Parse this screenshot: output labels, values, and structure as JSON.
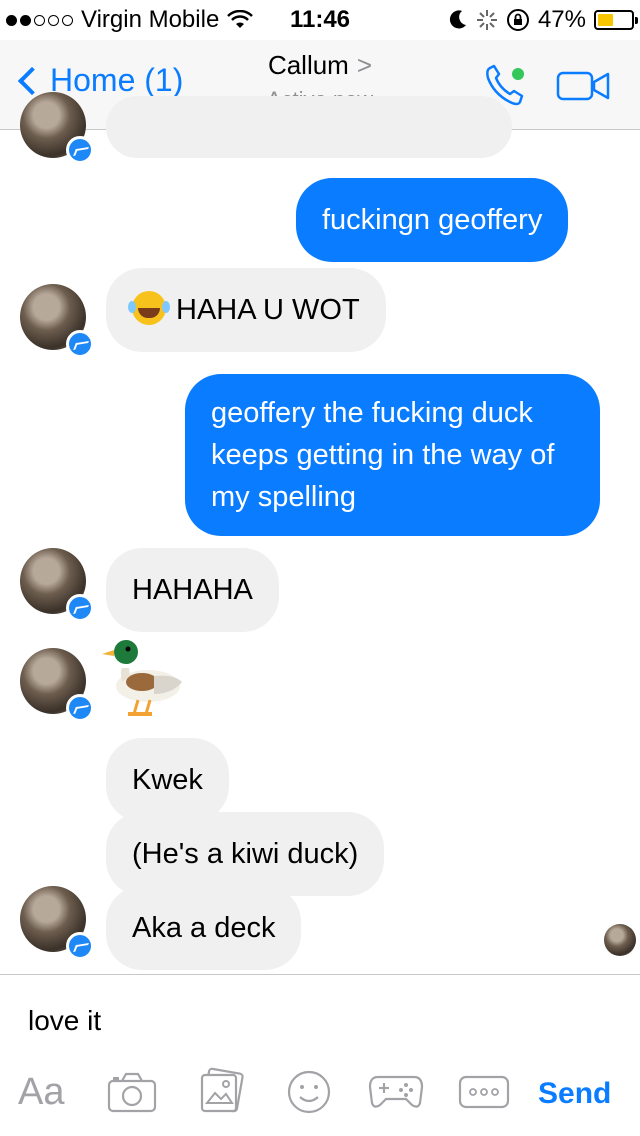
{
  "status_bar": {
    "carrier": "Virgin Mobile",
    "time": "11:46",
    "battery": "47%",
    "battery_level": 0.47,
    "signal_dots_on": 2,
    "signal_dots_total": 5
  },
  "nav": {
    "back_label": "Home (1)",
    "contact_name": "Callum",
    "contact_chevron": ">",
    "presence": "Active now",
    "accent": "#0a7cff",
    "online_dot": "#34c759"
  },
  "messages": [
    {
      "from": "them",
      "text": "fuckingn geoffery",
      "sender": "me"
    },
    {
      "from": "them",
      "text": "HAHA U WOT"
    },
    {
      "from": "me",
      "text": "geoffery the fucking duck keeps getting in the way of my spelling"
    },
    {
      "from": "them",
      "text": "HAHAHA"
    },
    {
      "from": "them",
      "text": "Kwek"
    },
    {
      "from": "them",
      "text": "(He's a kiwi duck)"
    },
    {
      "from": "them",
      "text": "Aka a deck"
    }
  ],
  "composer": {
    "text": "love it",
    "aa_label": "Aa",
    "send_label": "Send"
  },
  "icons": [
    "signal-dots-icon",
    "wifi-icon",
    "moon-icon",
    "activity-icon",
    "rotation-lock-icon",
    "battery-icon",
    "phone-icon",
    "video-camera-icon",
    "messenger-badge-icon",
    "duck-emoji",
    "tears-of-joy-emoji",
    "camera-icon",
    "gallery-icon",
    "smiley-icon",
    "game-controller-icon",
    "more-icon"
  ]
}
